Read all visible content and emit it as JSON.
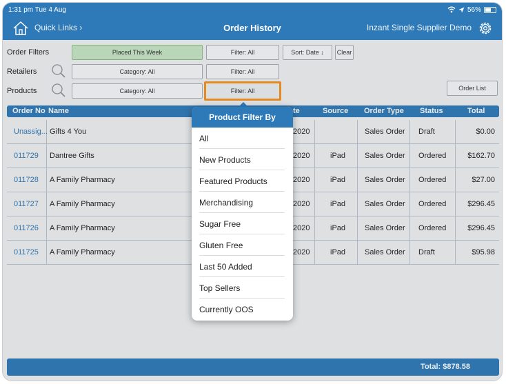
{
  "status_bar": {
    "time_date": "1:31 pm  Tue 4 Aug",
    "battery": "56%",
    "battery_level": 0.56
  },
  "nav": {
    "quick_links": "Quick Links ›",
    "title": "Order History",
    "company": "Inzant Single Supplier Demo"
  },
  "filters": {
    "order_filters_label": "Order Filters",
    "placed_this_week": "Placed This Week",
    "order_filter": "Filter: All",
    "sort": "Sort: Date ↓",
    "clear": "Clear",
    "retailers_label": "Retailers",
    "retailer_category": "Category: All",
    "retailer_filter": "Filter: All",
    "products_label": "Products",
    "product_category": "Category: All",
    "product_filter": "Filter: All",
    "order_list": "Order List"
  },
  "table": {
    "columns": {
      "order_no": "Order No",
      "name": "Name",
      "date": "te",
      "source": "Source",
      "order_type": "Order Type",
      "status": "Status",
      "total": "Total"
    },
    "rows": [
      {
        "order_no": "Unassig...",
        "name": "Gifts 4 You",
        "date": "2020",
        "source": "",
        "order_type": "Sales Order",
        "status": "Draft",
        "total": "$0.00"
      },
      {
        "order_no": "011729",
        "name": "Dantree Gifts",
        "date": "2020",
        "source": "iPad",
        "order_type": "Sales Order",
        "status": "Ordered",
        "total": "$162.70"
      },
      {
        "order_no": "011728",
        "name": "A Family Pharmacy",
        "date": "2020",
        "source": "iPad",
        "order_type": "Sales Order",
        "status": "Ordered",
        "total": "$27.00"
      },
      {
        "order_no": "011727",
        "name": "A Family Pharmacy",
        "date": "2020",
        "source": "iPad",
        "order_type": "Sales Order",
        "status": "Ordered",
        "total": "$296.45"
      },
      {
        "order_no": "011726",
        "name": "A Family Pharmacy",
        "date": "2020",
        "source": "iPad",
        "order_type": "Sales Order",
        "status": "Ordered",
        "total": "$296.45"
      },
      {
        "order_no": "011725",
        "name": "A Family Pharmacy",
        "date": "2020",
        "source": "iPad",
        "order_type": "Sales Order",
        "status": "Draft",
        "total": "$95.98"
      }
    ]
  },
  "footer": {
    "total": "Total: $878.58"
  },
  "popover": {
    "title": "Product Filter By",
    "items": [
      "All",
      "New Products",
      "Featured Products",
      "Merchandising",
      "Sugar Free",
      "Gluten Free",
      "Last 50 Added",
      "Top Sellers",
      "Currently OOS"
    ]
  },
  "colors": {
    "brand": "#2e7ab8",
    "highlight": "#f7941d",
    "green_button": "#c9e7c4"
  },
  "icons": {
    "home": "home-icon",
    "settings": "gear-icon",
    "search": "magnifier-icon",
    "wifi": "wifi-icon",
    "location": "location-arrow-icon",
    "battery": "battery-icon"
  }
}
